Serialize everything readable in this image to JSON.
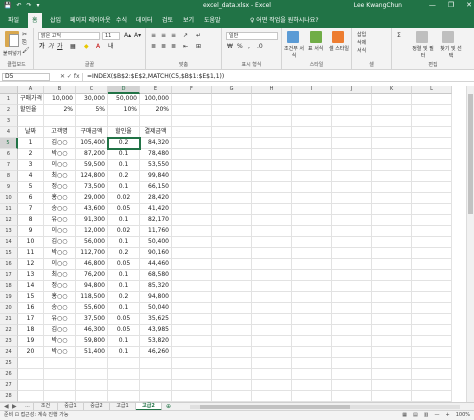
{
  "window": {
    "title": "excel_data.xlsx  -  Excel",
    "user": "Lee KwangChun",
    "qat": [
      "💾",
      "↶",
      "↷",
      "▾"
    ],
    "buttons": [
      "—",
      "❐",
      "✕"
    ]
  },
  "ribbon_tabs": [
    "파일",
    "홈",
    "삽입",
    "페이지 레이아웃",
    "수식",
    "데이터",
    "검토",
    "보기",
    "도움말"
  ],
  "active_tab_index": 1,
  "tell_me": "♀ 어떤 작업을 원하시나요?",
  "ribbon": {
    "clipboard": {
      "paste": "붙여넣기",
      "group": "클립보드"
    },
    "font": {
      "name": "맑은 고딕",
      "size": "11",
      "group": "글꼴",
      "buttons": [
        "가",
        "가",
        "가",
        "A▴",
        "A▾"
      ]
    },
    "alignment": {
      "group": "맞춤"
    },
    "number": {
      "format": "일반",
      "group": "표시 형식",
      "buttons": [
        "%",
        ",",
        ".0"
      ]
    },
    "styles": {
      "group": "스타일",
      "items": [
        "조건부 서식",
        "표 서식",
        "셀 스타일"
      ]
    },
    "cells": {
      "group": "셀",
      "items": [
        "삽입",
        "삭제",
        "서식"
      ]
    },
    "editing": {
      "group": "편집",
      "items": [
        "Σ",
        "정렬 및 필터",
        "찾기 및 선택"
      ]
    }
  },
  "formula_bar": {
    "name_box": "D5",
    "fx": "✕  ✓  fx",
    "formula": "=INDEX($B$2:$E$2,MATCH(C5,$B$1:$E$1,1))"
  },
  "columns": [
    "A",
    "B",
    "C",
    "D",
    "E",
    "F",
    "G",
    "H",
    "I",
    "J",
    "K",
    "L"
  ],
  "rows": [
    "1",
    "2",
    "3",
    "4",
    "5",
    "6",
    "7",
    "8",
    "9",
    "10",
    "11",
    "12",
    "13",
    "14",
    "15",
    "16",
    "17",
    "18",
    "19",
    "20",
    "21",
    "22",
    "23",
    "24",
    "25",
    "26",
    "27",
    "28"
  ],
  "header_rows": [
    [
      "구매가격",
      "10,000",
      "30,000",
      "50,000",
      "100,000"
    ],
    [
      "할인율",
      "2%",
      "5%",
      "10%",
      "20%"
    ]
  ],
  "table_headers": [
    "날짜",
    "고객명",
    "구매금액",
    "할인율",
    "결제금액"
  ],
  "table_rows": [
    [
      "1",
      "김○○",
      "105,400",
      "0.2",
      "84,320"
    ],
    [
      "2",
      "박○○",
      "87,200",
      "0.1",
      "78,480"
    ],
    [
      "3",
      "이○○",
      "59,500",
      "0.1",
      "53,550"
    ],
    [
      "4",
      "최○○",
      "124,800",
      "0.2",
      "99,840"
    ],
    [
      "5",
      "정○○",
      "73,500",
      "0.1",
      "66,150"
    ],
    [
      "6",
      "홍○○",
      "29,000",
      "0.02",
      "28,420"
    ],
    [
      "7",
      "송○○",
      "43,600",
      "0.05",
      "41,420"
    ],
    [
      "8",
      "유○○",
      "91,300",
      "0.1",
      "82,170"
    ],
    [
      "9",
      "이○○",
      "12,000",
      "0.02",
      "11,760"
    ],
    [
      "10",
      "김○○",
      "56,000",
      "0.1",
      "50,400"
    ],
    [
      "11",
      "박○○",
      "112,700",
      "0.2",
      "90,160"
    ],
    [
      "12",
      "이○○",
      "46,800",
      "0.05",
      "44,460"
    ],
    [
      "13",
      "최○○",
      "76,200",
      "0.1",
      "68,580"
    ],
    [
      "14",
      "정○○",
      "94,800",
      "0.1",
      "85,320"
    ],
    [
      "15",
      "홍○○",
      "118,500",
      "0.2",
      "94,800"
    ],
    [
      "16",
      "송○○",
      "55,600",
      "0.1",
      "50,040"
    ],
    [
      "17",
      "유○○",
      "37,500",
      "0.05",
      "35,625"
    ],
    [
      "18",
      "김○○",
      "46,300",
      "0.05",
      "43,985"
    ],
    [
      "19",
      "박○○",
      "59,800",
      "0.1",
      "53,820"
    ],
    [
      "20",
      "박○○",
      "51,400",
      "0.1",
      "46,260"
    ]
  ],
  "sheets": [
    "...",
    "조건",
    "중급1",
    "중급2",
    "고급1",
    "고급2"
  ],
  "active_sheet_index": 5,
  "sheet_nav": [
    "◀",
    "▶"
  ],
  "add_sheet": "⊕",
  "status": {
    "text": "준비  ⊡ 접근성: 계속 진행 가능",
    "right": [
      "▦",
      "▤",
      "▥",
      "—",
      "+",
      "100%"
    ]
  },
  "colors": {
    "accent": "#217346"
  }
}
